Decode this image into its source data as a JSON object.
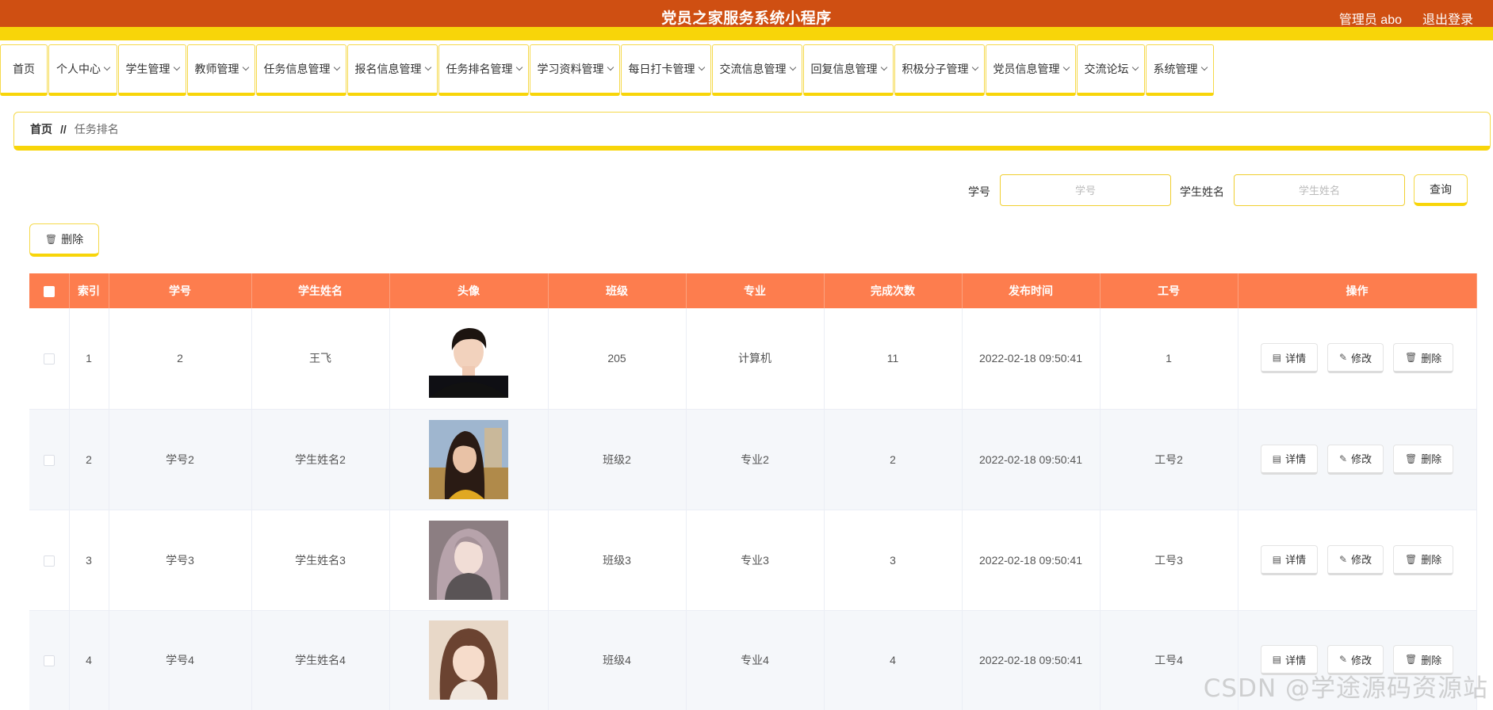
{
  "header": {
    "title": "党员之家服务系统小程序",
    "admin_label": "管理员 abo",
    "logout_label": "退出登录"
  },
  "nav": {
    "items": [
      {
        "label": "首页"
      },
      {
        "label": "个人中心"
      },
      {
        "label": "学生管理"
      },
      {
        "label": "教师管理"
      },
      {
        "label": "任务信息管理"
      },
      {
        "label": "报名信息管理"
      },
      {
        "label": "任务排名管理"
      },
      {
        "label": "学习资料管理"
      },
      {
        "label": "每日打卡管理"
      },
      {
        "label": "交流信息管理"
      },
      {
        "label": "回复信息管理"
      },
      {
        "label": "积极分子管理"
      },
      {
        "label": "党员信息管理"
      },
      {
        "label": "交流论坛"
      },
      {
        "label": "系统管理"
      }
    ]
  },
  "breadcrumb": {
    "home": "首页",
    "separator": "//",
    "current": "任务排名"
  },
  "search": {
    "student_no_label": "学号",
    "student_no_placeholder": "学号",
    "student_name_label": "学生姓名",
    "student_name_placeholder": "学生姓名",
    "query_label": "查询"
  },
  "toolbar": {
    "delete_label": "删除"
  },
  "table": {
    "headers": [
      "索引",
      "学号",
      "学生姓名",
      "头像",
      "班级",
      "专业",
      "完成次数",
      "发布时间",
      "工号",
      "操作"
    ],
    "rows": [
      {
        "index": "1",
        "student_no": "2",
        "student_name": "王飞",
        "avatar": "avatar-male",
        "class": "205",
        "major": "计算机",
        "count": "11",
        "time": "2022-02-18 09:50:41",
        "job_no": "1"
      },
      {
        "index": "2",
        "student_no": "学号2",
        "student_name": "学生姓名2",
        "avatar": "avatar-female-1",
        "class": "班级2",
        "major": "专业2",
        "count": "2",
        "time": "2022-02-18 09:50:41",
        "job_no": "工号2"
      },
      {
        "index": "3",
        "student_no": "学号3",
        "student_name": "学生姓名3",
        "avatar": "avatar-female-2",
        "class": "班级3",
        "major": "专业3",
        "count": "3",
        "time": "2022-02-18 09:50:41",
        "job_no": "工号3"
      },
      {
        "index": "4",
        "student_no": "学号4",
        "student_name": "学生姓名4",
        "avatar": "avatar-female-3",
        "class": "班级4",
        "major": "专业4",
        "count": "4",
        "time": "2022-02-18 09:50:41",
        "job_no": "工号4"
      }
    ],
    "actions": {
      "detail_label": "详情",
      "edit_label": "修改",
      "delete_label": "删除"
    }
  },
  "watermark": "CSDN @学途源码资源站",
  "colors": {
    "header_bg": "#cf4f12",
    "accent_yellow": "#f8d509",
    "table_header_bg": "#fd7d4e"
  }
}
